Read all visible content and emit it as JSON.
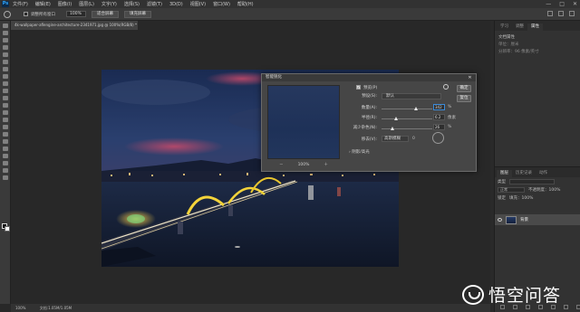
{
  "menubar": {
    "logo": "Ps",
    "items": [
      "文件(F)",
      "编辑(E)",
      "图像(I)",
      "图层(L)",
      "文字(Y)",
      "选择(S)",
      "滤镜(T)",
      "3D(D)",
      "视图(V)",
      "窗口(W)",
      "帮助(H)"
    ],
    "controls": [
      "—",
      "□",
      "✕"
    ]
  },
  "options_bar": {
    "checkbox_label": "调整所有窗口",
    "zoom_value": "100%",
    "btn_fit": "适合屏幕",
    "btn_fill": "填充屏幕"
  },
  "document": {
    "tab_title": "4k-wallpaper-aflengine-architecture-2341971.jpg @ 100%(RGB/8) *",
    "status_zoom": "100%",
    "status_doc": "文档:1.05M/1.05M"
  },
  "dialog": {
    "title": "智能锐化",
    "close": "✕",
    "preview_label": "预览(P)",
    "ok": "确定",
    "reset": "复位",
    "preset_label": "预设(S):",
    "preset_value": "默认",
    "amount_label": "数量(A):",
    "amount_value": "342",
    "amount_unit": "%",
    "radius_label": "半径(R):",
    "radius_value": "6.2",
    "radius_unit": "像素",
    "noise_label": "减少杂色(N):",
    "noise_value": "26",
    "noise_unit": "%",
    "remove_label": "移去(V):",
    "remove_value": "高斯模糊",
    "angle_label": "0",
    "shadow_highlight": "阴影/高光",
    "zoom_out": "－",
    "zoom_value": "100%",
    "zoom_in": "＋",
    "amount_level": 0.68,
    "radius_level": 0.28,
    "noise_level": 0.22
  },
  "props_panel": {
    "tabs": [
      "学习",
      "调整",
      "属性"
    ],
    "active_tab": 2,
    "title": "文档属性",
    "line": "单位：厘米",
    "hint": "分辨率：96 像素/英寸"
  },
  "layers_panel": {
    "tabs": [
      "图层",
      "历史记录",
      "动作"
    ],
    "kind_label": "类型",
    "blend_label": "正常",
    "opacity_label": "不透明度：100%",
    "lock_label": "锁定",
    "fill_label": "填充：100%",
    "layer_name": "背景"
  },
  "watermark": {
    "text": "悟空问答"
  },
  "colors": {
    "accent": "#3b8ad8",
    "dialog_bg": "#464646",
    "panel_bg": "#323232"
  }
}
